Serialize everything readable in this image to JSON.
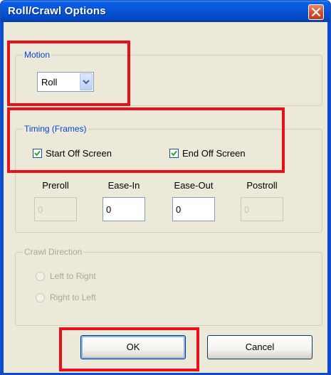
{
  "window": {
    "title": "Roll/Crawl Options"
  },
  "motion": {
    "group_label": "Motion",
    "selected": "Roll"
  },
  "timing": {
    "group_label": "Timing (Frames)",
    "start_off_screen": {
      "label": "Start Off Screen",
      "checked": true
    },
    "end_off_screen": {
      "label": "End Off Screen",
      "checked": true
    },
    "fields": [
      {
        "label": "Preroll",
        "value": "0",
        "enabled": false
      },
      {
        "label": "Ease-In",
        "value": "0",
        "enabled": true
      },
      {
        "label": "Ease-Out",
        "value": "0",
        "enabled": true
      },
      {
        "label": "Postroll",
        "value": "0",
        "enabled": false
      }
    ]
  },
  "crawl_direction": {
    "group_label": "Crawl Direction",
    "options": [
      {
        "label": "Left to Right",
        "enabled": false
      },
      {
        "label": "Right to Left",
        "enabled": false
      }
    ]
  },
  "buttons": {
    "ok": "OK",
    "cancel": "Cancel"
  },
  "colors": {
    "highlight": "#e8101a",
    "title_bar": "#0655d6",
    "dialog_bg": "#ece9d8",
    "group_label_blue": "#0046d5"
  }
}
